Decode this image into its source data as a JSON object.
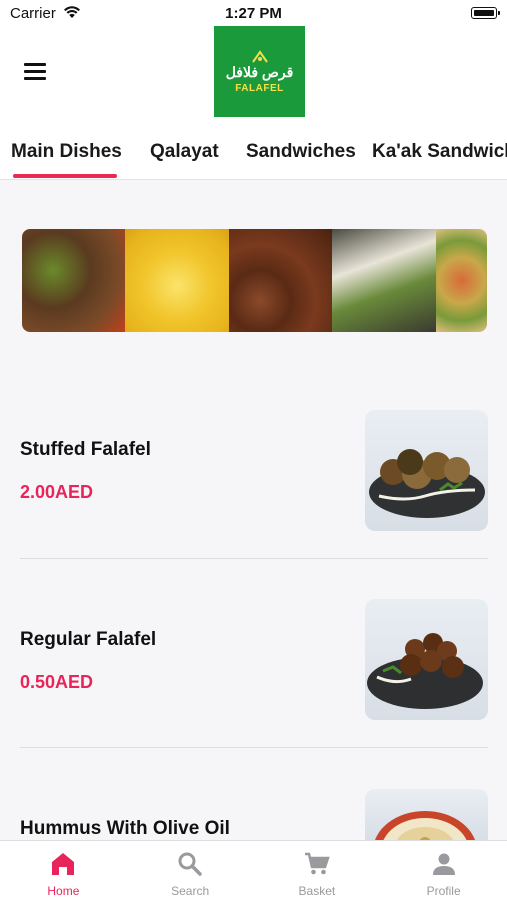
{
  "status": {
    "carrier": "Carrier",
    "time": "1:27 PM"
  },
  "header": {
    "logo_arabic": "قرص فلافل",
    "logo_english": "FALAFEL"
  },
  "tabs": [
    {
      "label": "Main Dishes"
    },
    {
      "label": "Qalayat"
    },
    {
      "label": "Sandwiches"
    },
    {
      "label": "Ka'ak Sandwich"
    }
  ],
  "items": [
    {
      "name": "Stuffed Falafel",
      "price": "2.00AED"
    },
    {
      "name": "Regular Falafel",
      "price": "0.50AED"
    },
    {
      "name": "Hummus With Olive Oil",
      "price": ""
    }
  ],
  "nav": [
    {
      "label": "Home",
      "icon": "home-icon"
    },
    {
      "label": "Search",
      "icon": "search-icon"
    },
    {
      "label": "Basket",
      "icon": "basket-icon"
    },
    {
      "label": "Profile",
      "icon": "profile-icon"
    }
  ],
  "colors": {
    "accent": "#e8255a",
    "brand": "#1a9a3a",
    "tab_underline": "#ea2a54"
  }
}
